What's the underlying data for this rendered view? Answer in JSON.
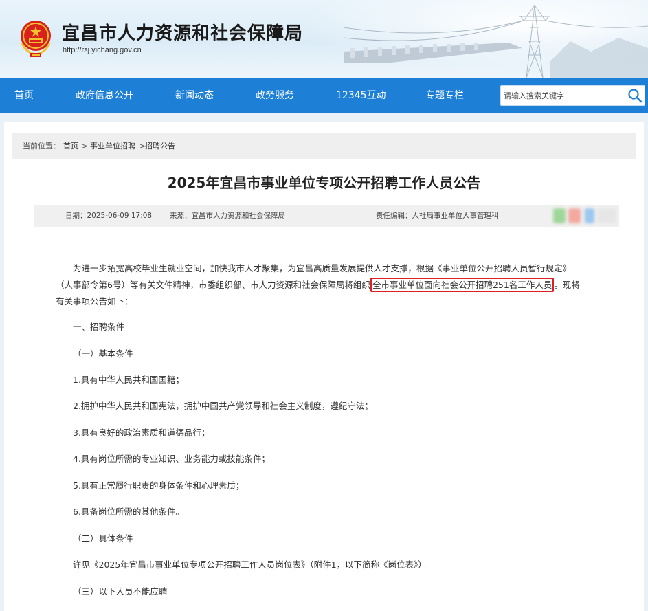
{
  "header": {
    "site_title": "宜昌市人力资源和社会保障局",
    "site_url": "http://rsj.yichang.gov.cn"
  },
  "nav": {
    "items": [
      "首页",
      "政府信息公开",
      "新闻动态",
      "政务服务",
      "12345互动",
      "专题专栏"
    ],
    "search_placeholder": "请输入搜索关键字"
  },
  "breadcrumb": {
    "prefix": "当前位置：",
    "items": [
      "首页",
      "事业单位招聘",
      "招聘公告"
    ],
    "separator": ">"
  },
  "article": {
    "title": "2025年宜昌市事业单位专项公开招聘工作人员公告",
    "meta": {
      "date": "日期：2025-06-09 17:08",
      "source": "来源：宜昌市人力资源和社会保障局",
      "editor": "责任编辑：人社局事业单位人事管理科"
    },
    "intro_line1": "为进一步拓宽高校毕业生就业空间，加快我市人才聚集，为宜昌高质量发展提供人才支撑，根据《事业单位公开招聘人员暂行规定》",
    "intro_line2_before": "（人事部令第6号）等有关文件精神，市委组织部、市人力资源和社会保障局将组织",
    "intro_line2_highlight": "全市事业单位面向社会公开招聘251名工作人员",
    "intro_line2_after": "。现将",
    "intro_line3": "有关事项公告如下：",
    "paragraphs": [
      "一、招聘条件",
      "（一）基本条件",
      "1.具有中华人民共和国国籍；",
      "2.拥护中华人民共和国宪法，拥护中国共产党领导和社会主义制度，遵纪守法；",
      "3.具有良好的政治素质和道德品行；",
      "4.具有岗位所需的专业知识、业务能力或技能条件；",
      "5.具有正常履行职责的身体条件和心理素质；",
      "6.具备岗位所需的其他条件。",
      "（二）具体条件",
      "详见《2025年宜昌市事业单位专项公开招聘工作人员岗位表》（附件1，以下简称《岗位表》）。",
      "（三）以下人员不能应聘"
    ]
  },
  "colors": {
    "nav_bg": "#1d7fd5",
    "highlight_border": "#e02020",
    "page_bg": "#eaf1f7"
  },
  "icons": {
    "emblem": "national-emblem-icon",
    "search": "search-icon"
  }
}
